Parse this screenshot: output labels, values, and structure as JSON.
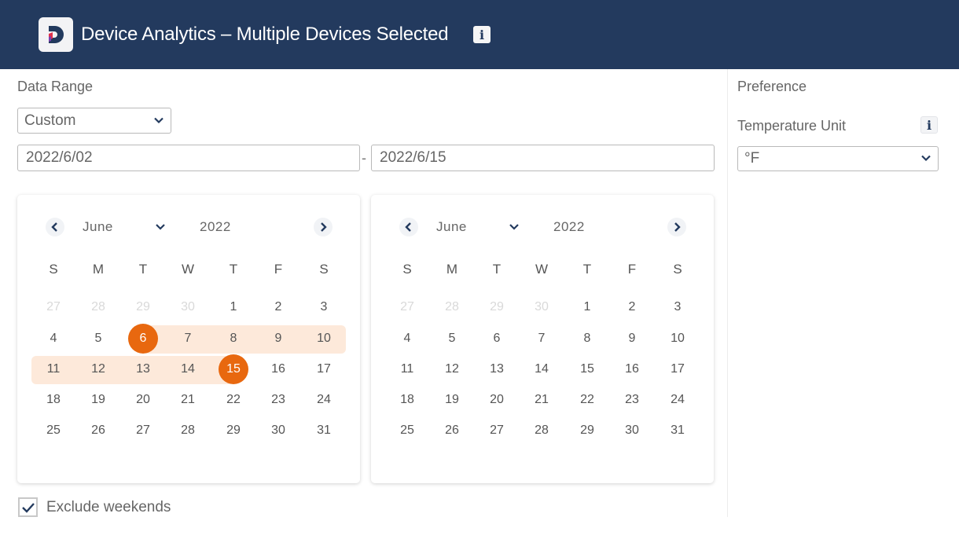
{
  "header": {
    "title": "Device Analytics – Multiple Devices Selected",
    "info_glyph": "i",
    "logo_letter": "D",
    "background": "#233a5e"
  },
  "date_range": {
    "label": "Data Range",
    "preset_selected": "Custom",
    "start_date": "2022/6/02",
    "separator": "-",
    "end_date": "2022/6/15"
  },
  "calendars": [
    {
      "month": "June",
      "year": "2022",
      "weekdays": [
        "S",
        "M",
        "T",
        "W",
        "T",
        "F",
        "S"
      ],
      "leading_days": [
        "27",
        "28",
        "29",
        "30"
      ],
      "days": [
        "1",
        "2",
        "3",
        "4",
        "5",
        "6",
        "7",
        "8",
        "9",
        "10",
        "11",
        "12",
        "13",
        "14",
        "15",
        "16",
        "17",
        "18",
        "19",
        "20",
        "21",
        "22",
        "23",
        "24",
        "25",
        "26",
        "27",
        "28",
        "29",
        "30",
        "31"
      ],
      "range_start": 6,
      "range_end": 15
    },
    {
      "month": "June",
      "year": "2022",
      "weekdays": [
        "S",
        "M",
        "T",
        "W",
        "T",
        "F",
        "S"
      ],
      "leading_days": [
        "27",
        "28",
        "29",
        "30"
      ],
      "days": [
        "1",
        "2",
        "3",
        "4",
        "5",
        "6",
        "7",
        "8",
        "9",
        "10",
        "11",
        "12",
        "13",
        "14",
        "15",
        "16",
        "17",
        "18",
        "19",
        "20",
        "21",
        "22",
        "23",
        "24",
        "25",
        "26",
        "27",
        "28",
        "29",
        "30",
        "31"
      ],
      "range_start": null,
      "range_end": null
    }
  ],
  "exclude_weekends": {
    "label": "Exclude weekends",
    "checked": true
  },
  "preference": {
    "label": "Preference",
    "temperature_unit_label": "Temperature Unit",
    "info_glyph": "i",
    "temperature_unit_selected": "°F"
  },
  "colors": {
    "accent": "#e8680f",
    "range_fill": "#fde9da",
    "navy": "#233a5e"
  }
}
